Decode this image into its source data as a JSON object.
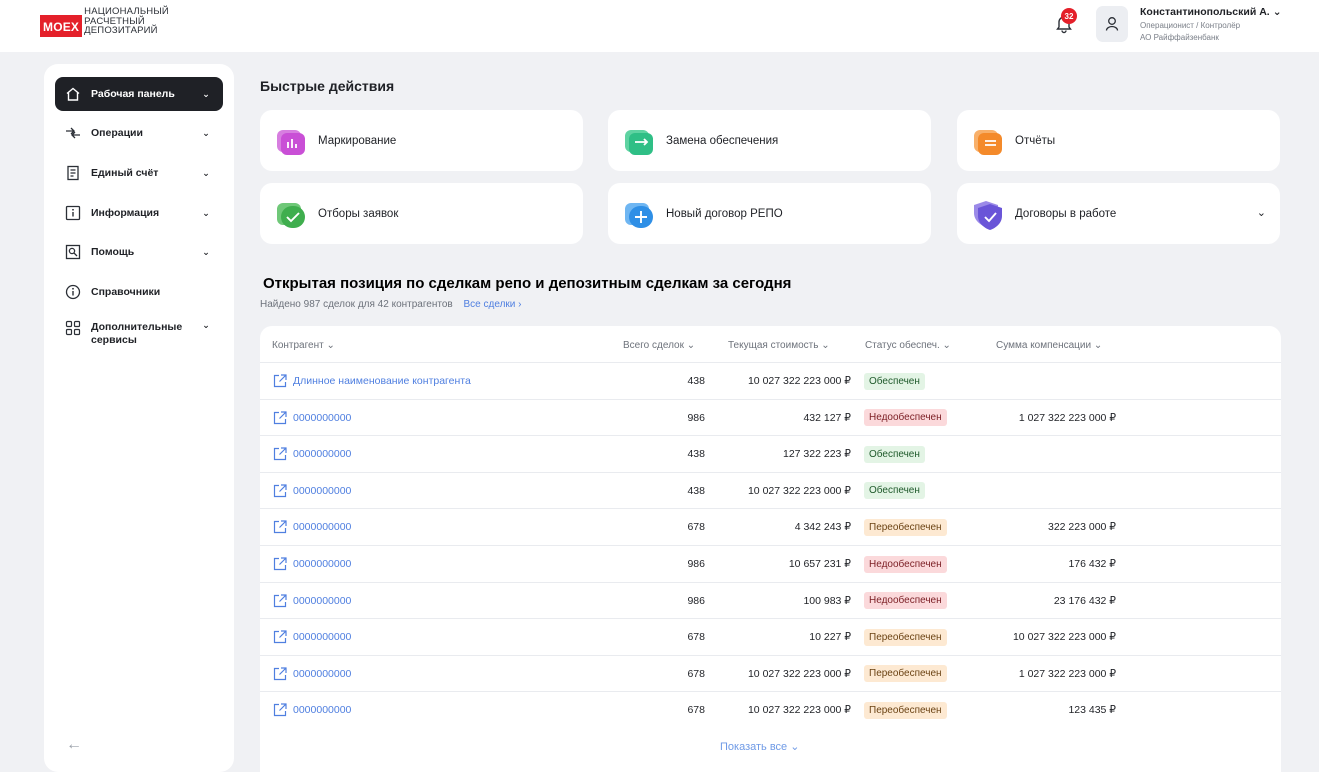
{
  "header": {
    "logo_mark": "MOEX",
    "logo_lines": [
      "НАЦИОНАЛЬНЫЙ",
      "РАСЧЕТНЫЙ",
      "ДЕПОЗИТАРИЙ"
    ],
    "notifications_count": "32",
    "user_name": "Константинопольский А.",
    "user_role": "Операционист / Контролёр",
    "user_org": "АО Райффайзенбанк"
  },
  "sidebar": {
    "items": [
      {
        "label": "Рабочая панель",
        "icon": "home-icon",
        "active": true,
        "has_chevron": true
      },
      {
        "label": "Операции",
        "icon": "arrows-icon",
        "active": false,
        "has_chevron": true
      },
      {
        "label": "Единый счёт",
        "icon": "document-icon",
        "active": false,
        "has_chevron": true
      },
      {
        "label": "Информация",
        "icon": "info-square-icon",
        "active": false,
        "has_chevron": true
      },
      {
        "label": "Помощь",
        "icon": "search-doc-icon",
        "active": false,
        "has_chevron": true
      },
      {
        "label": "Справочники",
        "icon": "info-circle-icon",
        "active": false,
        "has_chevron": false
      },
      {
        "label": "Дополнительные сервисы",
        "icon": "grid-icon",
        "active": false,
        "has_chevron": true
      }
    ],
    "collapse_icon": "arrow-left-icon"
  },
  "quick_actions": {
    "title": "Быстрые действия",
    "items": [
      {
        "label": "Маркирование",
        "icon": "marking-icon",
        "color": "#c94fd6"
      },
      {
        "label": "Замена обеспечения",
        "icon": "exchange-icon",
        "color": "#2fbf86"
      },
      {
        "label": "Отчёты",
        "icon": "reports-icon",
        "color": "#f48a2a"
      },
      {
        "label": "Отборы заявок",
        "icon": "check-icon",
        "color": "#3fae4e"
      },
      {
        "label": "Новый договор РЕПО",
        "icon": "plus-icon",
        "color": "#2f8fe6"
      },
      {
        "label": "Договоры в работе",
        "icon": "shield-check-icon",
        "color": "#6a55d8"
      }
    ]
  },
  "positions": {
    "title": "Открытая позиция по сделкам репо и депозитным сделкам за сегодня",
    "subtitle": "Найдено 987 сделок для 42 контрагентов",
    "all_deals_link": "Все сделки ›",
    "columns": [
      "Контрагент",
      "Всего сделок",
      "Текущая стоимость",
      "Статус обеспеч.",
      "Сумма компенсации"
    ],
    "rows": [
      {
        "name": "Длинное наименование контрагента",
        "deals": "438",
        "value": "10 027 322 223 000 ₽",
        "status": "Обеспечен",
        "status_type": "ok",
        "comp": ""
      },
      {
        "name": "0000000000",
        "deals": "986",
        "value": "432 127 ₽",
        "status": "Недообеспечен",
        "status_type": "under",
        "comp": "1 027 322 223 000 ₽"
      },
      {
        "name": "0000000000",
        "deals": "438",
        "value": "127 322 223 ₽",
        "status": "Обеспечен",
        "status_type": "ok",
        "comp": ""
      },
      {
        "name": "0000000000",
        "deals": "438",
        "value": "10 027 322 223 000 ₽",
        "status": "Обеспечен",
        "status_type": "ok",
        "comp": ""
      },
      {
        "name": "0000000000",
        "deals": "678",
        "value": "4 342 243 ₽",
        "status": "Переобеспечен",
        "status_type": "over",
        "comp": "322 223 000 ₽"
      },
      {
        "name": "0000000000",
        "deals": "986",
        "value": "10 657 231 ₽",
        "status": "Недообеспечен",
        "status_type": "under",
        "comp": "176 432 ₽"
      },
      {
        "name": "0000000000",
        "deals": "986",
        "value": "100 983 ₽",
        "status": "Недообеспечен",
        "status_type": "under",
        "comp": "23 176 432 ₽"
      },
      {
        "name": "0000000000",
        "deals": "678",
        "value": "10 227 ₽",
        "status": "Переобеспечен",
        "status_type": "over",
        "comp": "10 027 322 223 000 ₽"
      },
      {
        "name": "0000000000",
        "deals": "678",
        "value": "10 027 322 223 000 ₽",
        "status": "Переобеспечен",
        "status_type": "over",
        "comp": "1 027 322 223 000 ₽"
      },
      {
        "name": "0000000000",
        "deals": "678",
        "value": "10 027 322 223 000 ₽",
        "status": "Переобеспечен",
        "status_type": "over",
        "comp": "123 435 ₽"
      }
    ],
    "show_all": "Показать все"
  }
}
